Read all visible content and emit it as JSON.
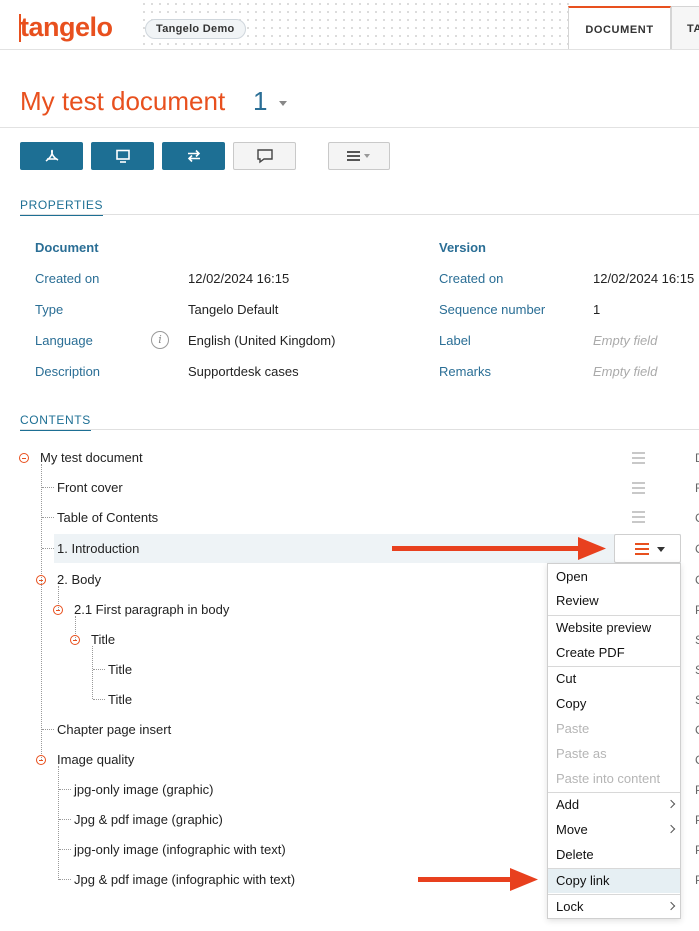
{
  "header": {
    "logo": "tangelo",
    "environment": "Tangelo Demo",
    "tabs": [
      {
        "label": "DOCUMENT"
      },
      {
        "label": "TA"
      }
    ]
  },
  "document": {
    "title": "My test document",
    "version": "1"
  },
  "toolbar": {
    "icons": [
      "pdf-icon",
      "monitor-icon",
      "swap-icon",
      "comment-icon",
      "menu-icon"
    ]
  },
  "properties": {
    "heading": "PROPERTIES",
    "document": {
      "heading": "Document",
      "rows": [
        {
          "label": "Created on",
          "value": "12/02/2024 16:15"
        },
        {
          "label": "Type",
          "value": "Tangelo Default"
        },
        {
          "label": "Language",
          "value": "English (United Kingdom)"
        },
        {
          "label": "Description",
          "value": "Supportdesk cases"
        }
      ]
    },
    "version": {
      "heading": "Version",
      "rows": [
        {
          "label": "Created on",
          "value": "12/02/2024 16:15"
        },
        {
          "label": "Sequence number",
          "value": "1"
        },
        {
          "label": "Label",
          "value": "Empty field"
        },
        {
          "label": "Remarks",
          "value": "Empty field"
        }
      ]
    }
  },
  "contents": {
    "heading": "CONTENTS",
    "tree": [
      {
        "label": "My test document",
        "edge": "D"
      },
      {
        "label": "Front cover",
        "edge": "F"
      },
      {
        "label": "Table of Contents",
        "edge": "C"
      },
      {
        "label": "1. Introduction",
        "edge": "C"
      },
      {
        "label": "2. Body",
        "edge": "C"
      },
      {
        "label": "2.1 First paragraph in body",
        "edge": "P"
      },
      {
        "label": "Title",
        "edge": "S"
      },
      {
        "label": "Title",
        "edge": "S"
      },
      {
        "label": "Title",
        "edge": "S"
      },
      {
        "label": "Chapter page insert",
        "edge": "C"
      },
      {
        "label": "Image quality",
        "edge": "C"
      },
      {
        "label": "jpg-only image (graphic)",
        "edge": "P"
      },
      {
        "label": "Jpg & pdf image (graphic)",
        "edge": "P"
      },
      {
        "label": "jpg-only image (infographic with text)",
        "edge": "P"
      },
      {
        "label": "Jpg & pdf image (infographic with text)",
        "edge": "P"
      }
    ]
  },
  "context_menu": {
    "items": [
      {
        "label": "Open"
      },
      {
        "label": "Review"
      },
      {
        "label": "Website preview"
      },
      {
        "label": "Create PDF"
      },
      {
        "label": "Cut"
      },
      {
        "label": "Copy"
      },
      {
        "label": "Paste"
      },
      {
        "label": "Paste as"
      },
      {
        "label": "Paste into content"
      },
      {
        "label": "Add"
      },
      {
        "label": "Move"
      },
      {
        "label": "Delete"
      },
      {
        "label": "Copy link"
      },
      {
        "label": "Lock"
      }
    ]
  },
  "colors": {
    "brand": "#e8501e",
    "primary": "#1d6f94",
    "label": "#2a6e95"
  }
}
